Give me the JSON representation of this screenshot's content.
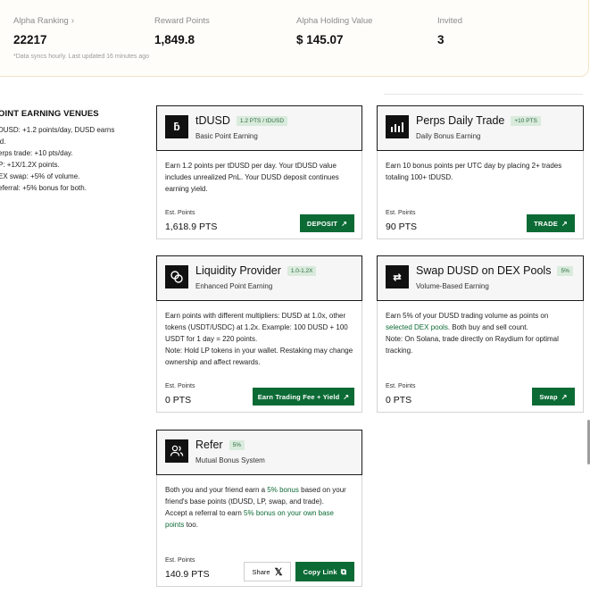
{
  "stats": {
    "ranking_label": "Alpha Ranking",
    "ranking_value": "22217",
    "reward_label": "Reward Points",
    "reward_value": "1,849.8",
    "holding_label": "Alpha Holding Value",
    "holding_value": "$ 145.07",
    "invited_label": "Invited",
    "invited_value": "3",
    "note": "*Data syncs hourly. Last updated 16 minutes ago"
  },
  "venues": {
    "title": "OINT EARNING VENUES",
    "lines": [
      "DUSD: +1.2 points/day, DUSD earns",
      "ld.",
      "erps trade: +10 pts/day.",
      "P: +1X/1.2X points.",
      "EX swap: +5% of volume.",
      "eferral: +5% bonus for both."
    ]
  },
  "cards": {
    "tdusd": {
      "title": "tDUSD",
      "badge": "1.2 PTS / tDUSD",
      "subtitle": "Basic Point Earning",
      "desc": "Earn 1.2 points per tDUSD per day. Your tDUSD value includes unrealized PnL. Your DUSD deposit continues earning yield.",
      "est_label": "Est. Points",
      "est_value": "1,618.9 PTS",
      "button": "DEPOSIT"
    },
    "perps": {
      "title": "Perps Daily Trade",
      "badge": "+10 PTS",
      "subtitle": "Daily Bonus Earning",
      "desc": "Earn 10 bonus points per UTC day by placing 2+ trades totaling 100+ tDUSD.",
      "est_label": "Est. Points",
      "est_value": "90 PTS",
      "button": "TRADE"
    },
    "lp": {
      "title": "Liquidity Provider",
      "badge": "1.0-1.2X",
      "subtitle": "Enhanced Point Earning",
      "desc": "Earn points with different multipliers: DUSD at 1.0x, other tokens (USDT/USDC) at 1.2x. Example: 100 DUSD + 100 USDT for 1 day = 220 points.",
      "note": "Note: Hold LP tokens in your wallet. Restaking may change ownership and affect rewards.",
      "est_label": "Est. Points",
      "est_value": "0 PTS",
      "button": "Earn Trading Fee + Yield"
    },
    "swap": {
      "title": "Swap DUSD on DEX Pools",
      "badge": "5%",
      "subtitle": "Volume-Based Earning",
      "desc_pre": "Earn 5% of your DUSD trading volume as points on ",
      "desc_link": "selected DEX pools",
      "desc_post": ". Both buy and sell count.",
      "note": "Note: On Solana, trade directly on Raydium for optimal tracking.",
      "est_label": "Est. Points",
      "est_value": "0 PTS",
      "button": "Swap"
    },
    "refer": {
      "title": "Refer",
      "badge": "5%",
      "subtitle": "Mutual Bonus System",
      "desc_pre": "Both you and your friend earn a ",
      "desc_link": "5% bonus",
      "desc_post": " based on your friend's base points (tDUSD, LP, swap, and trade).",
      "desc2_pre": "Accept a referral to earn ",
      "desc2_link": "5% bonus on your own base points",
      "desc2_post": " too.",
      "est_label": "Est. Points",
      "est_value": "140.9 PTS",
      "share_button": "Share",
      "copy_button": "Copy Link"
    }
  },
  "colors": {
    "accent_green": "#0c6b35",
    "badge_bg": "#d9ebdd",
    "stats_border": "#f2e3c4"
  }
}
